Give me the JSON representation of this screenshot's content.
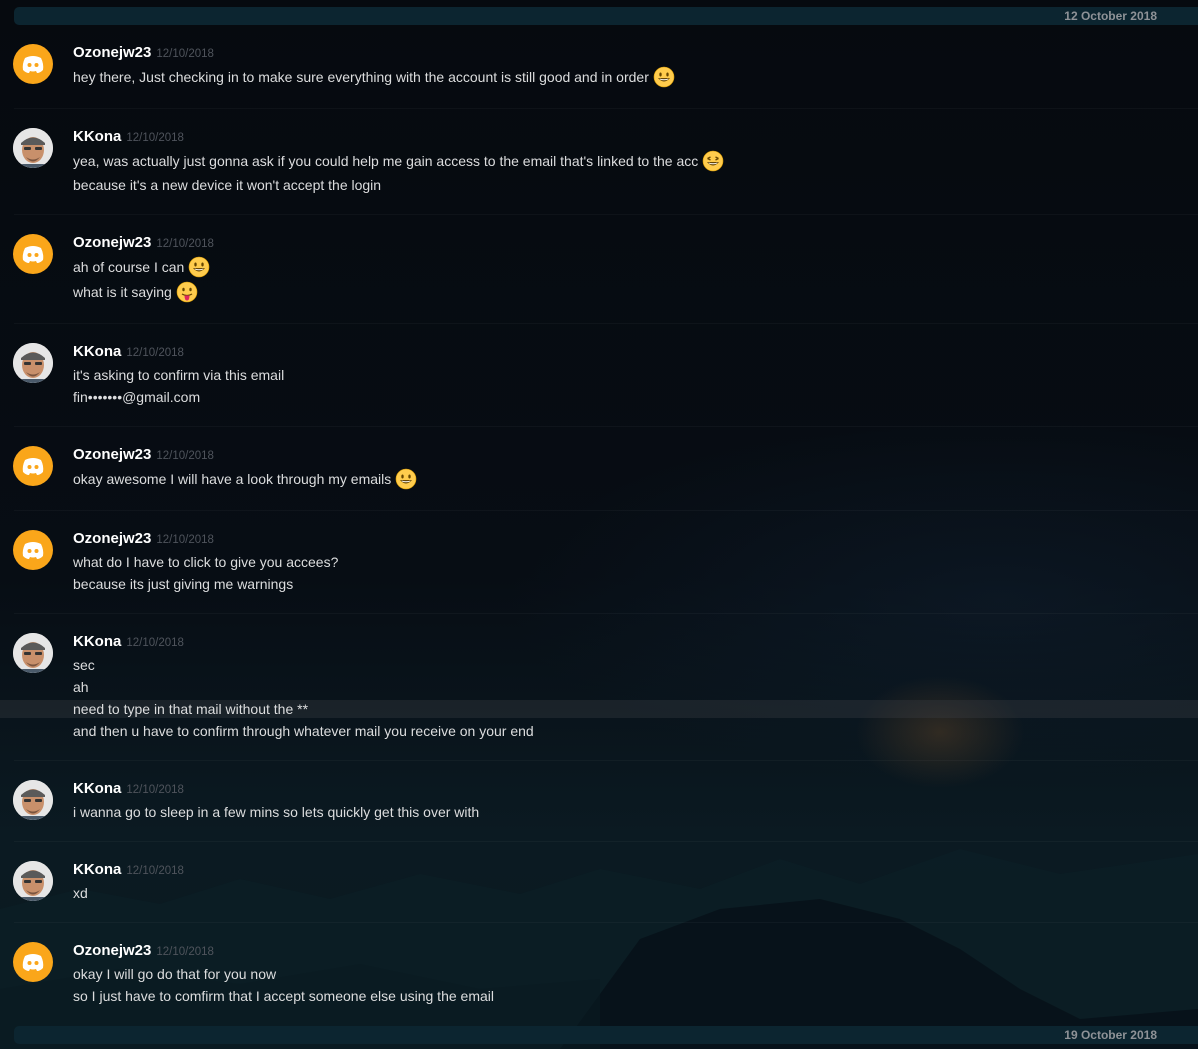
{
  "dividers": {
    "top_date": "12 October 2018",
    "bottom_date": "19 October 2018"
  },
  "messages": [
    {
      "author": "Ozonejw23",
      "timestamp": "12/10/2018",
      "avatar": "discord-logo-icon",
      "lines": [
        "hey there, Just checking in to make sure everything with the account is still good and in order"
      ],
      "emoji": [
        "grinning-face-icon"
      ]
    },
    {
      "author": "KKona",
      "timestamp": "12/10/2018",
      "avatar": "user-photo",
      "lines": [
        "yea, was actually just gonna ask if you could help me gain access to the email that's linked to the acc",
        "because it's a new device it won't accept the login"
      ],
      "emoji": [
        "grinning-squinting-face-icon"
      ]
    },
    {
      "author": "Ozonejw23",
      "timestamp": "12/10/2018",
      "avatar": "discord-logo-icon",
      "lines": [
        "ah of course I can",
        "what is it saying"
      ],
      "emoji": [
        "grinning-face-icon",
        "tongue-face-icon"
      ]
    },
    {
      "author": "KKona",
      "timestamp": "12/10/2018",
      "avatar": "user-photo",
      "lines": [
        "it's asking to confirm via this email",
        "fin•••••••@gmail.com"
      ]
    },
    {
      "author": "Ozonejw23",
      "timestamp": "12/10/2018",
      "avatar": "discord-logo-icon",
      "lines": [
        "okay awesome I will have a look through my emails"
      ],
      "emoji": [
        "grinning-face-icon"
      ]
    },
    {
      "author": "Ozonejw23",
      "timestamp": "12/10/2018",
      "avatar": "discord-logo-icon",
      "lines": [
        "what do I have to click to give you accees?",
        "because its just giving me warnings"
      ]
    },
    {
      "author": "KKona",
      "timestamp": "12/10/2018",
      "avatar": "user-photo",
      "lines": [
        "sec",
        "ah",
        "need to type in that mail without the  **",
        "and then u have to confirm through whatever mail you receive on your end"
      ]
    },
    {
      "author": "KKona",
      "timestamp": "12/10/2018",
      "avatar": "user-photo",
      "lines": [
        "i wanna go to sleep in a few mins so lets quickly get this over with"
      ]
    },
    {
      "author": "KKona",
      "timestamp": "12/10/2018",
      "avatar": "user-photo",
      "lines": [
        "xd"
      ]
    },
    {
      "author": "Ozonejw23",
      "timestamp": "12/10/2018",
      "avatar": "discord-logo-icon",
      "lines": [
        "okay I will go do that for you now",
        "so I just have to comfirm that I accept someone else using the email"
      ]
    }
  ],
  "colors": {
    "discord_avatar_bg": "#faa61a",
    "divider_bg": "#0c2530",
    "username": "#ffffff",
    "timestamp": "#4f545c",
    "message_text": "#dcddde"
  }
}
